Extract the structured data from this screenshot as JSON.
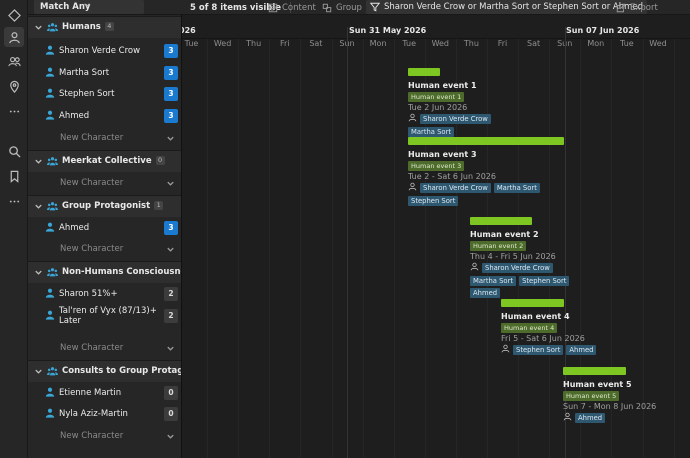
{
  "toolbar": {
    "match_label": "Match Any",
    "visible_count": "5 of 8 items visible",
    "content_label": "Content",
    "group_label": "Group",
    "filter_text": "Sharon Verde Crow or Martha Sort or Stephen Sort or Ahmed",
    "export_label": "Export"
  },
  "groups": [
    {
      "name": "Humans",
      "count": "4",
      "characters": [
        {
          "name": "Sharon Verde Crow",
          "badge": "3",
          "badge_color": "#1a7ad0"
        },
        {
          "name": "Martha Sort",
          "badge": "3",
          "badge_color": "#1a7ad0"
        },
        {
          "name": "Stephen Sort",
          "badge": "3",
          "badge_color": "#1a7ad0"
        },
        {
          "name": "Ahmed",
          "badge": "3",
          "badge_color": "#1a7ad0"
        }
      ],
      "new_label": "New Character"
    },
    {
      "name": "Meerkat Collective",
      "count": "0",
      "characters": [],
      "new_label": "New Character"
    },
    {
      "name": "Group Protagonist",
      "count": "1",
      "characters": [
        {
          "name": "Ahmed",
          "badge": "3",
          "badge_color": "#1a7ad0"
        }
      ],
      "new_label": "New Character"
    },
    {
      "name": "Non-Humans Consciousnesses",
      "count": "2",
      "characters": [
        {
          "name": "Sharon 51%+",
          "badge": "2",
          "badge_color": "#3c3c3c"
        },
        {
          "name": "Tal'ren of Vyx (87/13)+ Later",
          "badge": "2",
          "badge_color": "#3c3c3c"
        }
      ],
      "new_label": "New Character"
    },
    {
      "name": "Consults to Group Protagonist",
      "count": "2",
      "characters": [
        {
          "name": "Etienne Martin",
          "badge": "0",
          "badge_color": "#3c3c3c"
        },
        {
          "name": "Nyla Aziz-Martin",
          "badge": "0",
          "badge_color": "#3c3c3c"
        }
      ],
      "new_label": "New Character"
    }
  ],
  "timeline": {
    "weeks": [
      "026",
      "Sun 31 May 2026",
      "Sun 07 Jun 2026"
    ],
    "days": [
      "Tue",
      "Wed",
      "Thu",
      "Fri",
      "Sat",
      "Sun",
      "Mon",
      "Tue",
      "Wed",
      "Thu",
      "Fri",
      "Sat",
      "Sun",
      "Mon",
      "Tue",
      "Wed"
    ],
    "events": [
      {
        "title": "Human event 1",
        "tag": "Human event 1",
        "date": "Tue 2 Jun 2026",
        "people": [
          "Sharon Verde Crow",
          "Martha Sort"
        ]
      },
      {
        "title": "Human event 3",
        "tag": "Human event 3",
        "date": "Tue 2 - Sat 6 Jun 2026",
        "people": [
          "Sharon Verde Crow",
          "Martha Sort",
          "Stephen Sort"
        ]
      },
      {
        "title": "Human event 2",
        "tag": "Human event 2",
        "date": "Thu 4 - Fri 5 Jun 2026",
        "people": [
          "Sharon Verde Crow",
          "Martha Sort",
          "Stephen Sort",
          "Ahmed"
        ]
      },
      {
        "title": "Human event 4",
        "tag": "Human event 4",
        "date": "Fri 5 - Sat 6 Jun 2026",
        "people": [
          "Stephen Sort",
          "Ahmed"
        ]
      },
      {
        "title": "Human event 5",
        "tag": "Human event 5",
        "date": "Sun 7 - Mon 8 Jun 2026",
        "people": [
          "Ahmed"
        ]
      }
    ],
    "bar_color": "#7ec622"
  },
  "icons": {
    "rail": [
      "diamond-icon",
      "person-icon",
      "people-icon",
      "location-pin-icon",
      "more-icon",
      "search-icon",
      "bookmark-icon",
      "more-icon"
    ]
  }
}
